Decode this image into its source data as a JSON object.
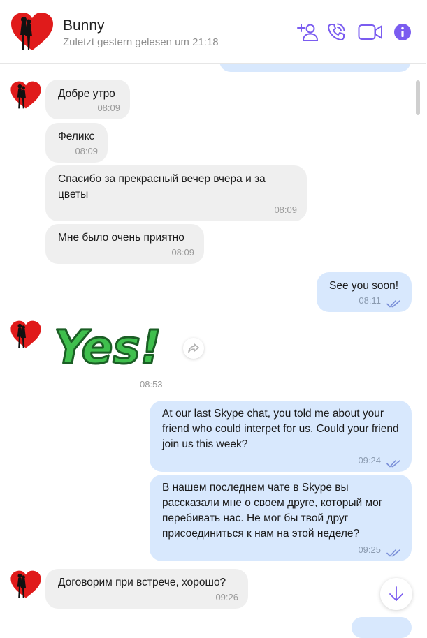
{
  "contact": {
    "name": "Bunny",
    "status": "Zuletzt gestern gelesen um 21:18"
  },
  "header_icons": [
    "add-contact-icon",
    "phone-icon",
    "video-camera-icon",
    "info-icon"
  ],
  "colors": {
    "accent": "#7a5cf0",
    "incoming_bubble": "#efefef",
    "outgoing_bubble": "#d8e8fd",
    "sticker_green": "#3fbf4d",
    "heart_red": "#e01b1b"
  },
  "messages": [
    {
      "dir": "in",
      "text": "Добре утро",
      "time": "08:09"
    },
    {
      "dir": "in",
      "text": "Феликс",
      "time": "08:09"
    },
    {
      "dir": "in",
      "text": "Спасибо за прекрасный вечер вчера и за цветы",
      "time": "08:09"
    },
    {
      "dir": "in",
      "text": "Мне было очень приятно",
      "time": "08:09"
    },
    {
      "dir": "out",
      "text": "See you soon!",
      "time": "08:11"
    },
    {
      "dir": "in",
      "sticker": "Yes!",
      "time": "08:53"
    },
    {
      "dir": "out",
      "text": "At our last Skype chat, you told me about your friend who could interpet for us. Could your friend join us this week?",
      "time": "09:24"
    },
    {
      "dir": "out",
      "text": "В нашем последнем чате в Skype вы рассказали мне о своем друге, который мог перебивать нас. Не мог бы твой друг присоединиться к нам на этой неделе?",
      "time": "09:25"
    },
    {
      "dir": "in",
      "text": "Договорим при встрече, хорошо?",
      "time": "09:26"
    }
  ]
}
